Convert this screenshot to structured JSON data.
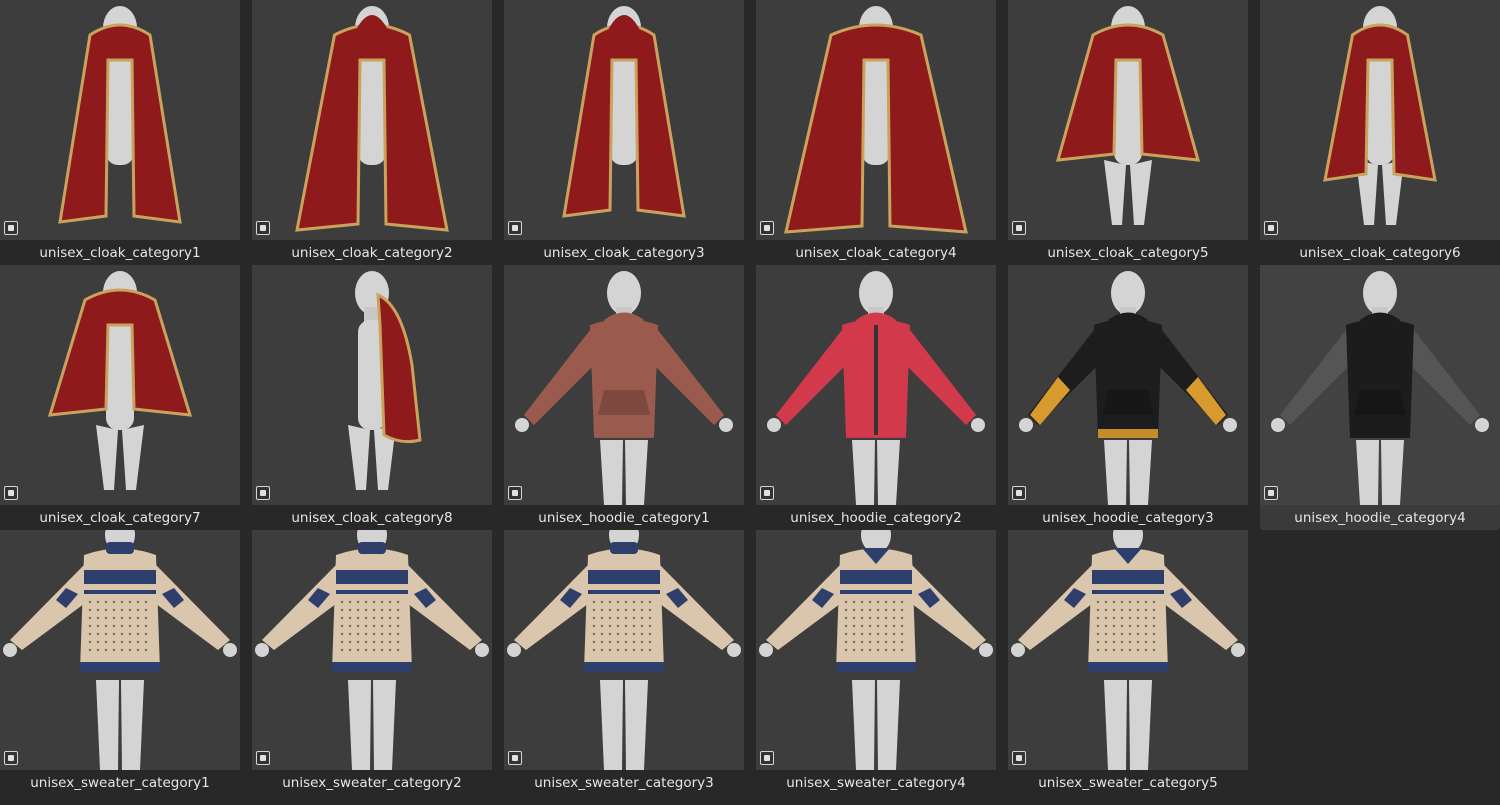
{
  "assets": [
    {
      "label": "unisex_cloak_category1",
      "kind": "cloak",
      "variant": 1,
      "selected": false
    },
    {
      "label": "unisex_cloak_category2",
      "kind": "cloak",
      "variant": 2,
      "selected": false
    },
    {
      "label": "unisex_cloak_category3",
      "kind": "cloak",
      "variant": 3,
      "selected": false
    },
    {
      "label": "unisex_cloak_category4",
      "kind": "cloak",
      "variant": 4,
      "selected": false
    },
    {
      "label": "unisex_cloak_category5",
      "kind": "cloak",
      "variant": 5,
      "selected": false
    },
    {
      "label": "unisex_cloak_category6",
      "kind": "cloak",
      "variant": 6,
      "selected": false
    },
    {
      "label": "unisex_cloak_category7",
      "kind": "cloak",
      "variant": 7,
      "selected": false
    },
    {
      "label": "unisex_cloak_category8",
      "kind": "cloak",
      "variant": 8,
      "selected": false
    },
    {
      "label": "unisex_hoodie_category1",
      "kind": "hoodie",
      "variant": 1,
      "selected": false
    },
    {
      "label": "unisex_hoodie_category2",
      "kind": "hoodie",
      "variant": 2,
      "selected": false
    },
    {
      "label": "unisex_hoodie_category3",
      "kind": "hoodie",
      "variant": 3,
      "selected": false
    },
    {
      "label": "unisex_hoodie_category4",
      "kind": "hoodie",
      "variant": 4,
      "selected": true
    },
    {
      "label": "unisex_sweater_category1",
      "kind": "sweater",
      "variant": 1,
      "selected": false
    },
    {
      "label": "unisex_sweater_category2",
      "kind": "sweater",
      "variant": 2,
      "selected": false
    },
    {
      "label": "unisex_sweater_category3",
      "kind": "sweater",
      "variant": 3,
      "selected": false
    },
    {
      "label": "unisex_sweater_category4",
      "kind": "sweater",
      "variant": 4,
      "selected": false
    },
    {
      "label": "unisex_sweater_category5",
      "kind": "sweater",
      "variant": 5,
      "selected": false
    }
  ],
  "colors": {
    "background": "#282828",
    "thumbnail": "#3d3d3d",
    "mannequin": "#d4d4d4",
    "cloak_red": "#8e1a1c",
    "cloak_trim": "#c9a35c",
    "hoodie_colors": [
      "#9a5a4e",
      "#d23a4c",
      "#1d1d1d",
      "#1c1c1c"
    ],
    "hoodie_accent": [
      "#9a5a4e",
      "#d23a4c",
      "#d79a2e",
      "#5a5a5a"
    ],
    "sweater_cream": "#d9c6ad",
    "sweater_navy": "#2e3f6b"
  }
}
